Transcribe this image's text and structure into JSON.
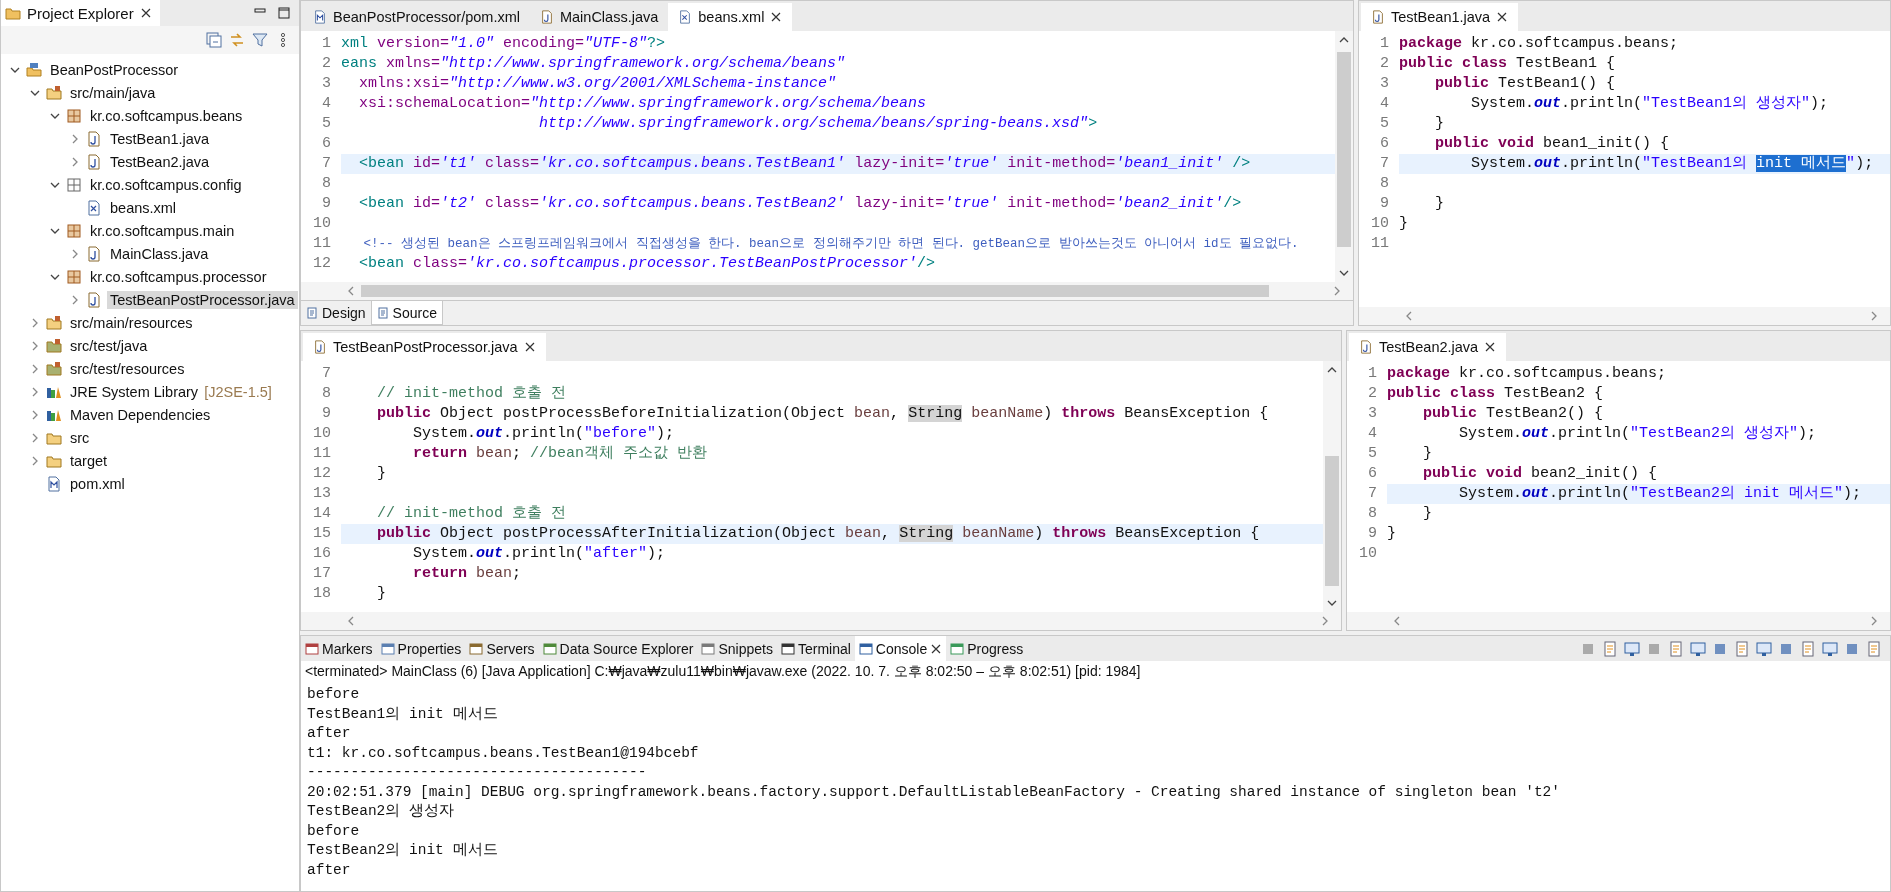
{
  "explorer": {
    "title": "Project Explorer",
    "tree": [
      {
        "label": "BeanPostProcessor",
        "kind": "project",
        "expanded": true,
        "selected": false,
        "children": [
          {
            "label": "src/main/java",
            "kind": "srcfolder",
            "expanded": true,
            "selected": false,
            "children": [
              {
                "label": "kr.co.softcampus.beans",
                "kind": "package",
                "expanded": true,
                "selected": false,
                "children": [
                  {
                    "label": "TestBean1.java",
                    "kind": "java",
                    "expanded": false,
                    "selected": false
                  },
                  {
                    "label": "TestBean2.java",
                    "kind": "java",
                    "expanded": false,
                    "selected": false
                  }
                ]
              },
              {
                "label": "kr.co.softcampus.config",
                "kind": "config",
                "expanded": true,
                "selected": false,
                "children": [
                  {
                    "label": "beans.xml",
                    "kind": "xml",
                    "selected": false
                  }
                ]
              },
              {
                "label": "kr.co.softcampus.main",
                "kind": "package",
                "expanded": true,
                "selected": false,
                "children": [
                  {
                    "label": "MainClass.java",
                    "kind": "java",
                    "expanded": false,
                    "selected": false
                  }
                ]
              },
              {
                "label": "kr.co.softcampus.processor",
                "kind": "package",
                "expanded": true,
                "selected": false,
                "children": [
                  {
                    "label": "TestBeanPostProcessor.java",
                    "kind": "java",
                    "expanded": false,
                    "selected": true
                  }
                ]
              }
            ]
          },
          {
            "label": "src/main/resources",
            "kind": "srcfolder",
            "expanded": false,
            "selected": false
          },
          {
            "label": "src/test/java",
            "kind": "testfolder",
            "expanded": false,
            "selected": false
          },
          {
            "label": "src/test/resources",
            "kind": "testfolder",
            "expanded": false,
            "selected": false
          },
          {
            "label": "JRE System Library",
            "decoration": "[J2SE-1.5]",
            "kind": "library",
            "expanded": false,
            "selected": false
          },
          {
            "label": "Maven Dependencies",
            "kind": "library",
            "expanded": false,
            "selected": false
          },
          {
            "label": "src",
            "kind": "folder",
            "expanded": false,
            "selected": false
          },
          {
            "label": "target",
            "kind": "folder",
            "expanded": false,
            "selected": false
          },
          {
            "label": "pom.xml",
            "kind": "pom",
            "selected": false
          }
        ]
      }
    ]
  },
  "editors": [
    {
      "tabs": [
        {
          "label": "BeanPostProcessor/pom.xml",
          "kind": "pom",
          "selected": false
        },
        {
          "label": "MainClass.java",
          "kind": "java",
          "selected": false
        },
        {
          "label": "beans.xml",
          "kind": "xml",
          "selected": true
        }
      ],
      "lines": [
        {
          "n": "1",
          "current": false,
          "tokens": [
            {
              "kind": "tag",
              "text": "xml"
            },
            {
              "kind": "attr",
              "text": " version="
            },
            {
              "kind": "val",
              "text": "\"1.0\""
            },
            {
              "kind": "attr",
              "text": " encoding="
            },
            {
              "kind": "val",
              "text": "\"UTF-8\""
            },
            {
              "kind": "tag",
              "text": "?>"
            }
          ]
        },
        {
          "n": "2",
          "current": false,
          "tokens": [
            {
              "kind": "tag",
              "text": "eans"
            },
            {
              "kind": "attr",
              "text": " xmlns="
            },
            {
              "kind": "val",
              "text": "\"http://www.springframework.org/schema/beans\""
            }
          ]
        },
        {
          "n": "3",
          "current": false,
          "tokens": [
            {
              "kind": "attr",
              "text": "  xmlns:xsi="
            },
            {
              "kind": "val",
              "text": "\"http://www.w3.org/2001/XMLSchema-instance\""
            }
          ]
        },
        {
          "n": "4",
          "current": false,
          "tokens": [
            {
              "kind": "attr",
              "text": "  xsi:schemaLocation="
            },
            {
              "kind": "val",
              "text": "\"http://www.springframework.org/schema/beans"
            }
          ]
        },
        {
          "n": "5",
          "current": false,
          "tokens": [
            {
              "kind": "val",
              "text": "                      http://www.springframework.org/schema/beans/spring-beans.xsd\""
            },
            {
              "kind": "tag",
              "text": ">"
            }
          ]
        },
        {
          "n": "6",
          "current": false
        },
        {
          "n": "7",
          "current": true,
          "tokens": [
            {
              "kind": "tag",
              "text": "  <bean"
            },
            {
              "kind": "attr",
              "text": " id="
            },
            {
              "kind": "val",
              "text": "'t1'"
            },
            {
              "kind": "attr",
              "text": " class="
            },
            {
              "kind": "val",
              "text": "'kr.co.softcampus.beans.TestBean1'"
            },
            {
              "kind": "attr",
              "text": " lazy-init="
            },
            {
              "kind": "val",
              "text": "'true'"
            },
            {
              "kind": "attr",
              "text": " init-method="
            },
            {
              "kind": "val",
              "text": "'bean1_init'"
            },
            {
              "kind": "tag",
              "text": " />"
            }
          ]
        },
        {
          "n": "8",
          "current": false
        },
        {
          "n": "9",
          "current": false,
          "tokens": [
            {
              "kind": "tag",
              "text": "  <bean"
            },
            {
              "kind": "attr",
              "text": " id="
            },
            {
              "kind": "val",
              "text": "'t2'"
            },
            {
              "kind": "attr",
              "text": " class="
            },
            {
              "kind": "val",
              "text": "'kr.co.softcampus.beans.TestBean2'"
            },
            {
              "kind": "attr",
              "text": " lazy-init="
            },
            {
              "kind": "val",
              "text": "'true'"
            },
            {
              "kind": "attr",
              "text": " init-method="
            },
            {
              "kind": "val",
              "text": "'bean2_init'"
            },
            {
              "kind": "tag",
              "text": "/>"
            }
          ]
        },
        {
          "n": "10",
          "current": false
        },
        {
          "n": "11",
          "current": false,
          "tokens": [
            {
              "kind": "xcom",
              "text": "   <!-- 생성된 bean은 스프링프레임워크에서 직접생성을 한다. bean으로 정의해주기만 하면 된다. getBean으로 받아쓰는것도 아니어서 id도 필요없다."
            }
          ]
        },
        {
          "n": "12",
          "current": false,
          "tokens": [
            {
              "kind": "tag",
              "text": "  <bean"
            },
            {
              "kind": "attr",
              "text": " class="
            },
            {
              "kind": "val",
              "text": "'kr.co.softcampus.processor.TestBeanPostProcessor'"
            },
            {
              "kind": "tag",
              "text": "/>"
            }
          ]
        }
      ],
      "view_tabs": [
        {
          "label": "Design",
          "selected": false
        },
        {
          "label": "Source",
          "selected": true
        }
      ]
    },
    {
      "tabs": [
        {
          "label": "TestBean1.java",
          "kind": "java",
          "selected": true
        }
      ],
      "lines": [
        {
          "n": "1",
          "current": false,
          "tokens": [
            {
              "kind": "kw",
              "text": "package"
            },
            {
              "kind": "plain",
              "text": " kr.co.softcampus.beans;"
            }
          ]
        },
        {
          "n": "2",
          "current": false,
          "tokens": [
            {
              "kind": "kw",
              "text": "public class"
            },
            {
              "kind": "plain",
              "text": " TestBean1 {"
            }
          ]
        },
        {
          "n": "3",
          "current": false,
          "tokens": [
            {
              "kind": "kw",
              "text": "    public"
            },
            {
              "kind": "plain",
              "text": " TestBean1() {"
            }
          ]
        },
        {
          "n": "4",
          "current": false,
          "tokens": [
            {
              "kind": "plain",
              "text": "        System."
            },
            {
              "kind": "field",
              "text": "out"
            },
            {
              "kind": "plain",
              "text": ".println("
            },
            {
              "kind": "str",
              "text": "\"TestBean1의 생성자\""
            },
            {
              "kind": "plain",
              "text": ");"
            }
          ]
        },
        {
          "n": "5",
          "current": false,
          "tokens": [
            {
              "kind": "plain",
              "text": "    }"
            }
          ]
        },
        {
          "n": "6",
          "current": false,
          "tokens": [
            {
              "kind": "kw",
              "text": "    public void"
            },
            {
              "kind": "plain",
              "text": " bean1_init() {"
            }
          ]
        },
        {
          "n": "7",
          "current": true,
          "tokens": [
            {
              "kind": "plain",
              "text": "        System."
            },
            {
              "kind": "field",
              "text": "out"
            },
            {
              "kind": "plain",
              "text": ".println("
            },
            {
              "kind": "str",
              "text": "\"TestBean1의 "
            },
            {
              "kind": "sel",
              "text": "init 메서드"
            },
            {
              "kind": "str",
              "text": "\""
            },
            {
              "kind": "plain",
              "text": ");"
            }
          ]
        },
        {
          "n": "8",
          "current": false
        },
        {
          "n": "9",
          "current": false,
          "tokens": [
            {
              "kind": "plain",
              "text": "    }"
            }
          ]
        },
        {
          "n": "10",
          "current": false,
          "tokens": [
            {
              "kind": "plain",
              "text": "}"
            }
          ]
        },
        {
          "n": "11",
          "current": false
        }
      ]
    },
    {
      "tabs": [
        {
          "label": "TestBeanPostProcessor.java",
          "kind": "java",
          "selected": true
        }
      ],
      "lines": [
        {
          "n": "7",
          "current": false
        },
        {
          "n": "8",
          "current": false,
          "tokens": [
            {
              "kind": "com",
              "text": "    // init-method 호출 전"
            }
          ]
        },
        {
          "n": "9",
          "current": false,
          "tokens": [
            {
              "kind": "kw",
              "text": "    public"
            },
            {
              "kind": "plain",
              "text": " Object postProcessBeforeInitialization(Object "
            },
            {
              "kind": "var",
              "text": "bean"
            },
            {
              "kind": "plain",
              "text": ", "
            },
            {
              "kind": "hl",
              "text": "String"
            },
            {
              "kind": "var",
              "text": " beanName"
            },
            {
              "kind": "plain",
              "text": ") "
            },
            {
              "kind": "kw",
              "text": "throws"
            },
            {
              "kind": "plain",
              "text": " BeansException {"
            }
          ]
        },
        {
          "n": "10",
          "current": false,
          "tokens": [
            {
              "kind": "plain",
              "text": "        System."
            },
            {
              "kind": "field",
              "text": "out"
            },
            {
              "kind": "plain",
              "text": ".println("
            },
            {
              "kind": "str",
              "text": "\"before\""
            },
            {
              "kind": "plain",
              "text": ");"
            }
          ]
        },
        {
          "n": "11",
          "current": false,
          "tokens": [
            {
              "kind": "kw",
              "text": "        return"
            },
            {
              "kind": "var",
              "text": " bean"
            },
            {
              "kind": "plain",
              "text": "; "
            },
            {
              "kind": "com",
              "text": "//bean객체 주소값 반환"
            }
          ]
        },
        {
          "n": "12",
          "current": false,
          "tokens": [
            {
              "kind": "plain",
              "text": "    }"
            }
          ]
        },
        {
          "n": "13",
          "current": false
        },
        {
          "n": "14",
          "current": false,
          "tokens": [
            {
              "kind": "com",
              "text": "    // init-method 호출 전"
            }
          ]
        },
        {
          "n": "15",
          "current": true,
          "tokens": [
            {
              "kind": "kw",
              "text": "    public"
            },
            {
              "kind": "plain",
              "text": " Object postProcessAfterInitialization(Object "
            },
            {
              "kind": "var",
              "text": "bean"
            },
            {
              "kind": "plain",
              "text": ", "
            },
            {
              "kind": "hl",
              "text": "String"
            },
            {
              "kind": "var",
              "text": " beanName"
            },
            {
              "kind": "plain",
              "text": ") "
            },
            {
              "kind": "kw",
              "text": "throws"
            },
            {
              "kind": "plain",
              "text": " BeansException {"
            }
          ]
        },
        {
          "n": "16",
          "current": false,
          "tokens": [
            {
              "kind": "plain",
              "text": "        System."
            },
            {
              "kind": "field",
              "text": "out"
            },
            {
              "kind": "plain",
              "text": ".println("
            },
            {
              "kind": "str",
              "text": "\"after\""
            },
            {
              "kind": "plain",
              "text": ");"
            }
          ]
        },
        {
          "n": "17",
          "current": false,
          "tokens": [
            {
              "kind": "kw",
              "text": "        return"
            },
            {
              "kind": "var",
              "text": " bean"
            },
            {
              "kind": "plain",
              "text": ";"
            }
          ]
        },
        {
          "n": "18",
          "current": false,
          "tokens": [
            {
              "kind": "plain",
              "text": "    }"
            }
          ]
        }
      ]
    },
    {
      "tabs": [
        {
          "label": "TestBean2.java",
          "kind": "java",
          "selected": true
        }
      ],
      "lines": [
        {
          "n": "1",
          "current": false,
          "tokens": [
            {
              "kind": "kw",
              "text": "package"
            },
            {
              "kind": "plain",
              "text": " kr.co.softcampus.beans;"
            }
          ]
        },
        {
          "n": "2",
          "current": false,
          "tokens": [
            {
              "kind": "kw",
              "text": "public class"
            },
            {
              "kind": "plain",
              "text": " TestBean2 {"
            }
          ]
        },
        {
          "n": "3",
          "current": false,
          "tokens": [
            {
              "kind": "kw",
              "text": "    public"
            },
            {
              "kind": "plain",
              "text": " TestBean2() {"
            }
          ]
        },
        {
          "n": "4",
          "current": false,
          "tokens": [
            {
              "kind": "plain",
              "text": "        System."
            },
            {
              "kind": "field",
              "text": "out"
            },
            {
              "kind": "plain",
              "text": ".println("
            },
            {
              "kind": "str",
              "text": "\"TestBean2의 생성자\""
            },
            {
              "kind": "plain",
              "text": ");"
            }
          ]
        },
        {
          "n": "5",
          "current": false,
          "tokens": [
            {
              "kind": "plain",
              "text": "    }"
            }
          ]
        },
        {
          "n": "6",
          "current": false,
          "tokens": [
            {
              "kind": "kw",
              "text": "    public void"
            },
            {
              "kind": "plain",
              "text": " bean2_init() {"
            }
          ]
        },
        {
          "n": "7",
          "current": true,
          "tokens": [
            {
              "kind": "plain",
              "text": "        System."
            },
            {
              "kind": "field",
              "text": "out"
            },
            {
              "kind": "plain",
              "text": ".println("
            },
            {
              "kind": "str",
              "text": "\"TestBean2의 init 메서드\""
            },
            {
              "kind": "plain",
              "text": ");"
            }
          ]
        },
        {
          "n": "8",
          "current": false,
          "tokens": [
            {
              "kind": "plain",
              "text": "    }"
            }
          ]
        },
        {
          "n": "9",
          "current": false,
          "tokens": [
            {
              "kind": "plain",
              "text": "}"
            }
          ]
        },
        {
          "n": "10",
          "current": false
        }
      ]
    }
  ],
  "console": {
    "tabs": [
      {
        "label": "Markers",
        "selected": false
      },
      {
        "label": "Properties",
        "selected": false
      },
      {
        "label": "Servers",
        "selected": false
      },
      {
        "label": "Data Source Explorer",
        "selected": false
      },
      {
        "label": "Snippets",
        "selected": false
      },
      {
        "label": "Terminal",
        "selected": false
      },
      {
        "label": "Console",
        "selected": true
      },
      {
        "label": "Progress",
        "selected": false
      }
    ],
    "header": "<terminated> MainClass (6) [Java Application] C:₩java₩zulu11₩bin₩javaw.exe  (2022. 10. 7. 오후 8:02:50 – 오후 8:02:51) [pid: 1984]",
    "lines": [
      "before",
      "TestBean1의 init 메서드",
      "after",
      "t1: kr.co.softcampus.beans.TestBean1@194bcebf",
      "---------------------------------------",
      "20:02:51.379 [main] DEBUG org.springframework.beans.factory.support.DefaultListableBeanFactory - Creating shared instance of singleton bean 't2'",
      "TestBean2의 생성자",
      "before",
      "TestBean2의 init 메서드",
      "after"
    ]
  }
}
